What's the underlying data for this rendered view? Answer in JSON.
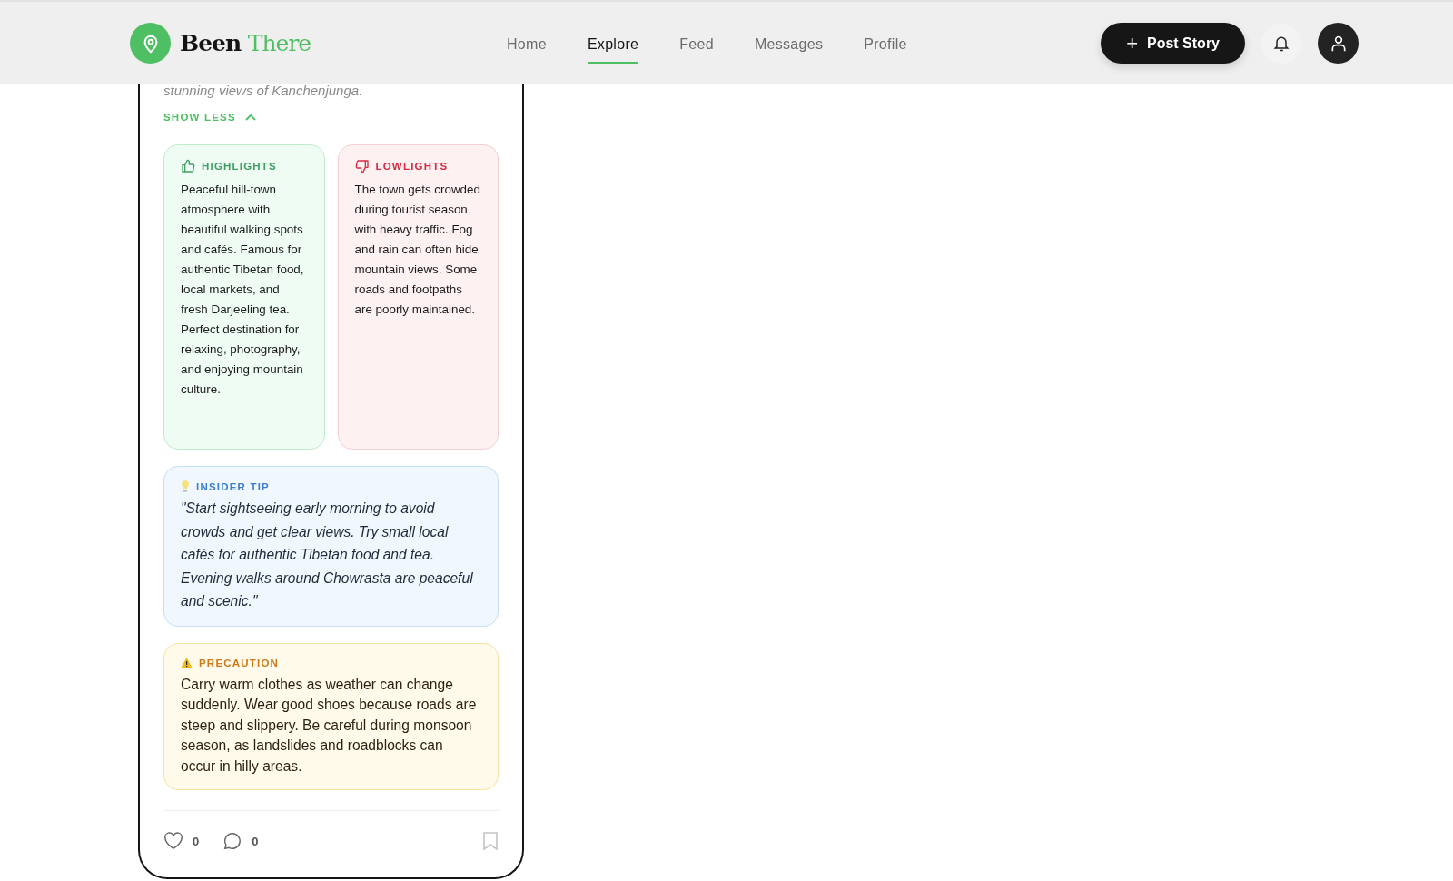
{
  "header": {
    "logo": {
      "first": "Been",
      "second": "There"
    },
    "nav": [
      {
        "label": "Home",
        "selected": false
      },
      {
        "label": "Explore",
        "selected": true
      },
      {
        "label": "Feed",
        "selected": false
      },
      {
        "label": "Messages",
        "selected": false
      },
      {
        "label": "Profile",
        "selected": false
      }
    ],
    "post_button": {
      "icon": "+",
      "label": "Post Story"
    }
  },
  "story": {
    "description_tail": "stunning views of Kanchenjunga.",
    "toggle": "SHOW LESS",
    "sections": [
      {
        "kind": "highlights",
        "title": "HIGHLIGHTS",
        "text": "Peaceful hill-town atmosphere with beautiful walking spots and cafés. Famous for authentic Tibetan food, local markets, and fresh Darjeeling tea. Perfect destination for relaxing, photography, and enjoying mountain culture."
      },
      {
        "kind": "lowlights",
        "title": "LOWLIGHTS",
        "text": "The town gets crowded during tourist season with heavy traffic. Fog and rain can often hide mountain views. Some roads and footpaths are poorly maintained."
      },
      {
        "kind": "tip",
        "title": "INSIDER TIP",
        "text": "\"Start sightseeing early morning to avoid crowds and get clear views. Try small local cafés for authentic Tibetan food and tea. Evening walks around Chowrasta are peaceful and scenic.\""
      },
      {
        "kind": "precaution",
        "title": "PRECAUTION",
        "text": "Carry warm clothes as weather can change suddenly. Wear good shoes because roads are steep and slippery. Be careful during monsoon season, as landslides and roadblocks can occur in hilly areas."
      }
    ],
    "likes": "0",
    "comments": "0",
    "saved": false
  }
}
